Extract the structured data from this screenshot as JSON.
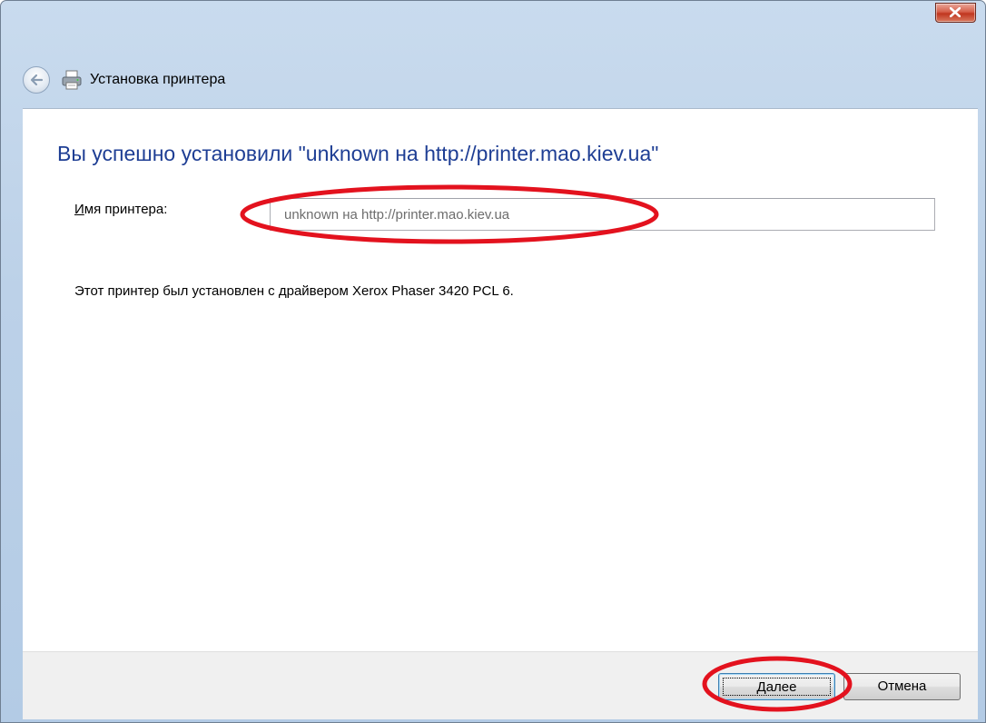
{
  "window": {
    "title": "Установка принтера"
  },
  "content": {
    "heading": "Вы успешно установили \"unknown на http://printer.mao.kiev.ua\"",
    "name_label_accel": "И",
    "name_label_rest": "мя принтера:",
    "printer_name_value": "unknown на http://printer.mao.kiev.ua",
    "driver_text": "Этот принтер был установлен с драйвером Xerox Phaser 3420 PCL 6."
  },
  "footer": {
    "next_accel": "Д",
    "next_rest": "алее",
    "cancel_label": "Отмена"
  },
  "colors": {
    "heading": "#1e3e94",
    "annotation": "#e3121e",
    "titlebar": "#bcd1e8",
    "close_button": "#c0361f"
  },
  "icons": [
    "back-arrow-icon",
    "printer-icon",
    "close-icon"
  ]
}
